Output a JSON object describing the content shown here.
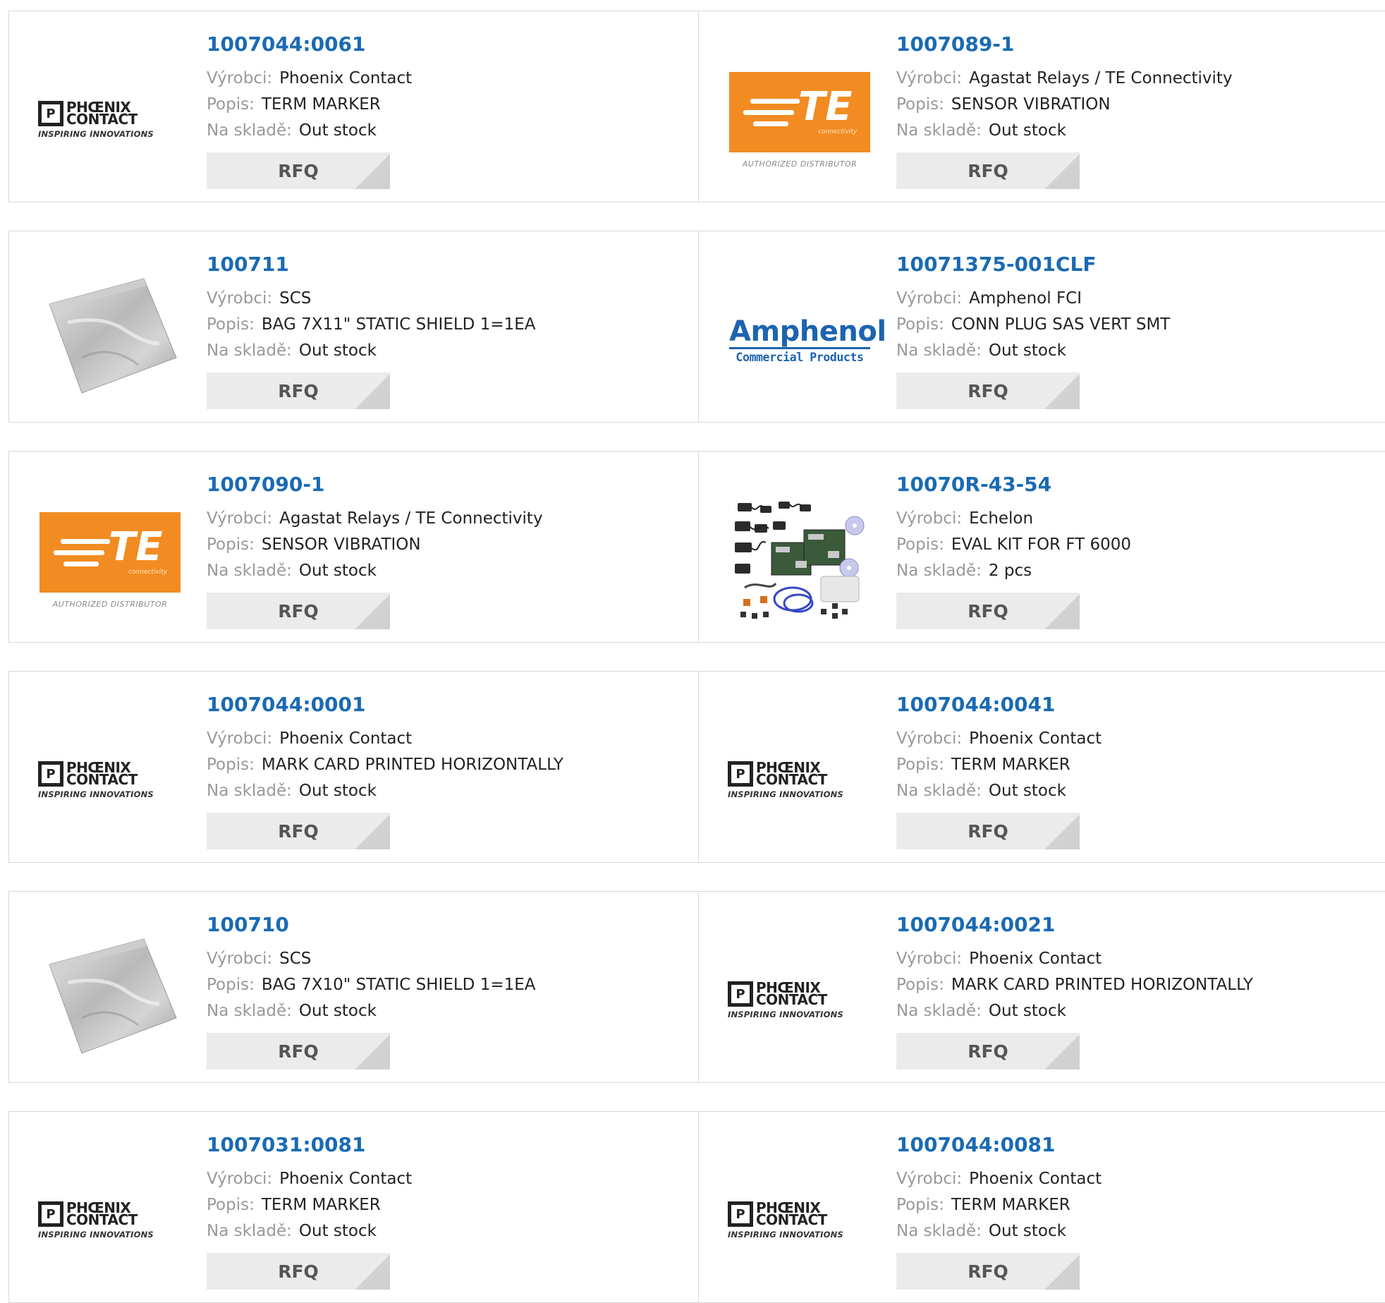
{
  "labels": {
    "manufacturer": "Výrobci:",
    "description": "Popis:",
    "stock": "Na skladě:",
    "rfq": "RFQ"
  },
  "logos": {
    "phoenix": {
      "box": "P",
      "line1": "PHŒNIX",
      "line2": "CONTACT",
      "tagline": "INSPIRING INNOVATIONS"
    },
    "te": {
      "mark": "TE",
      "sub": "connectivity",
      "footer": "AUTHORIZED DISTRIBUTOR"
    },
    "amphenol": {
      "name": "Amphenol",
      "sub": "Commercial Products"
    }
  },
  "colors": {
    "part_link": "#1a6ab4",
    "te_orange": "#f28c22",
    "amphenol_blue": "#1e63b0"
  },
  "products": [
    {
      "part": "1007044:0061",
      "manufacturer": "Phoenix Contact",
      "description": "TERM MARKER",
      "stock": "Out stock",
      "image": "phoenix-logo"
    },
    {
      "part": "1007089-1",
      "manufacturer": "Agastat Relays / TE Connectivity",
      "description": "SENSOR VIBRATION",
      "stock": "Out stock",
      "image": "te-logo"
    },
    {
      "part": "100711",
      "manufacturer": "SCS",
      "description": "BAG 7X11\" STATIC SHIELD 1=1EA",
      "stock": "Out stock",
      "image": "static-bag-photo"
    },
    {
      "part": "10071375-001CLF",
      "manufacturer": "Amphenol FCI",
      "description": "CONN PLUG SAS VERT SMT",
      "stock": "Out stock",
      "image": "amphenol-logo"
    },
    {
      "part": "1007090-1",
      "manufacturer": "Agastat Relays / TE Connectivity",
      "description": "SENSOR VIBRATION",
      "stock": "Out stock",
      "image": "te-logo"
    },
    {
      "part": "10070R-43-54",
      "manufacturer": "Echelon",
      "description": "EVAL KIT FOR FT 6000",
      "stock": "2 pcs",
      "image": "eval-kit-photo"
    },
    {
      "part": "1007044:0001",
      "manufacturer": "Phoenix Contact",
      "description": "MARK CARD PRINTED HORIZONTALLY",
      "stock": "Out stock",
      "image": "phoenix-logo"
    },
    {
      "part": "1007044:0041",
      "manufacturer": "Phoenix Contact",
      "description": "TERM MARKER",
      "stock": "Out stock",
      "image": "phoenix-logo"
    },
    {
      "part": "100710",
      "manufacturer": "SCS",
      "description": "BAG 7X10\" STATIC SHIELD 1=1EA",
      "stock": "Out stock",
      "image": "static-bag-photo"
    },
    {
      "part": "1007044:0021",
      "manufacturer": "Phoenix Contact",
      "description": "MARK CARD PRINTED HORIZONTALLY",
      "stock": "Out stock",
      "image": "phoenix-logo"
    },
    {
      "part": "1007031:0081",
      "manufacturer": "Phoenix Contact",
      "description": "TERM MARKER",
      "stock": "Out stock",
      "image": "phoenix-logo"
    },
    {
      "part": "1007044:0081",
      "manufacturer": "Phoenix Contact",
      "description": "TERM MARKER",
      "stock": "Out stock",
      "image": "phoenix-logo"
    }
  ]
}
